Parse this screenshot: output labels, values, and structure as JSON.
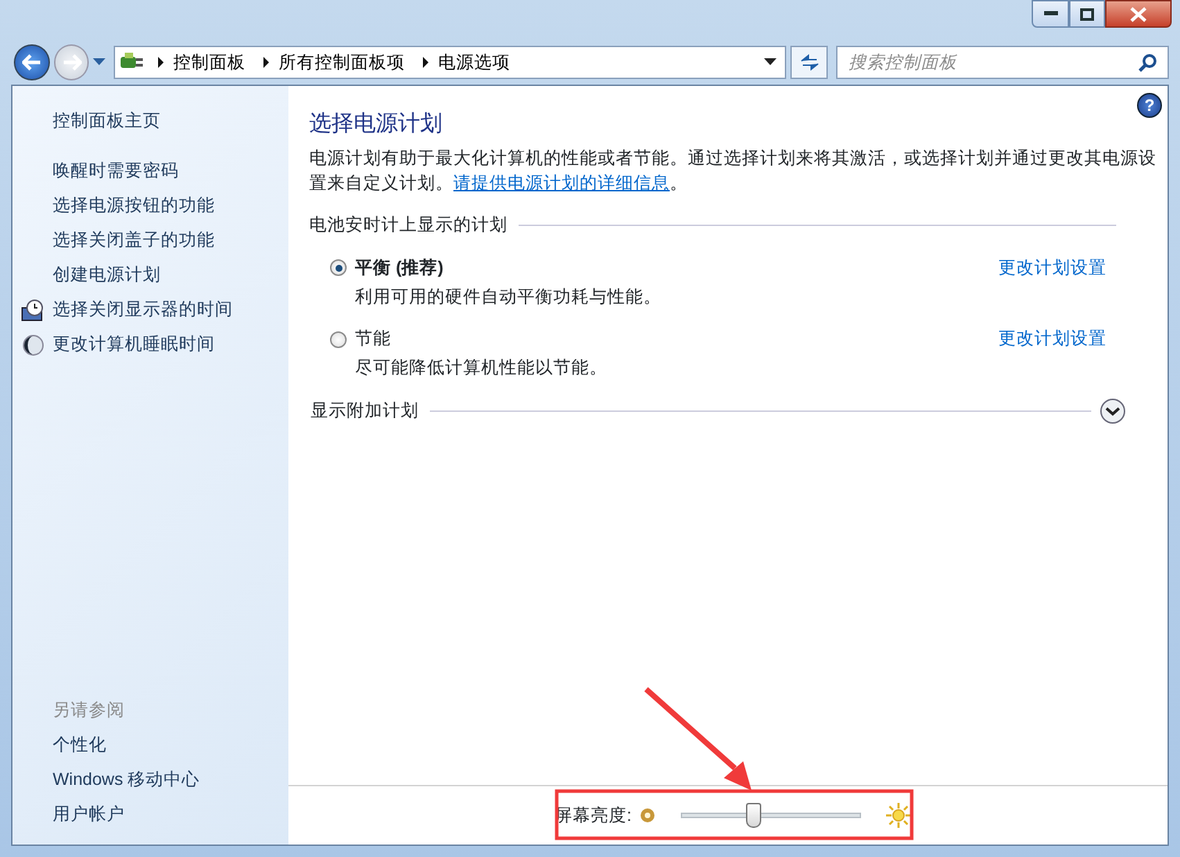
{
  "address_bar": {
    "breadcrumbs": [
      "控制面板",
      "所有控制面板项",
      "电源选项"
    ]
  },
  "search": {
    "placeholder": "搜索控制面板"
  },
  "help": "?",
  "sidebar": {
    "home": "控制面板主页",
    "tasks": [
      {
        "label": "唤醒时需要密码",
        "kind": "link"
      },
      {
        "label": "选择电源按钮的功能",
        "kind": "link"
      },
      {
        "label": "选择关闭盖子的功能",
        "kind": "link"
      },
      {
        "label": "创建电源计划",
        "kind": "link"
      },
      {
        "label": "选择关闭显示器的时间",
        "kind": "clock"
      },
      {
        "label": "更改计算机睡眠时间",
        "kind": "moon"
      }
    ],
    "see_also": {
      "heading": "另请参阅",
      "links": [
        "个性化",
        "Windows 移动中心",
        "用户帐户"
      ]
    }
  },
  "main": {
    "title": "选择电源计划",
    "description": {
      "text": "电源计划有助于最大化计算机的性能或者节能。通过选择计划来将其激活，或选择计划并通过更改其电源设置来自定义计划。",
      "link": "请提供电源计划的详细信息",
      "after": "。"
    },
    "plan_group": {
      "heading": "电池安时计上显示的计划",
      "plans": [
        {
          "name": "平衡 (推荐)",
          "description": "利用可用的硬件自动平衡功耗与性能。",
          "selected": true,
          "settings_link": "更改计划设置"
        },
        {
          "name": "节能",
          "description": "尽可能降低计算机性能以节能。",
          "selected": false,
          "settings_link": "更改计划设置"
        }
      ]
    },
    "more_plans": {
      "label": "显示附加计划",
      "expanded": false
    }
  },
  "brightness": {
    "label": "屏幕亮度:",
    "level": 0.4
  }
}
